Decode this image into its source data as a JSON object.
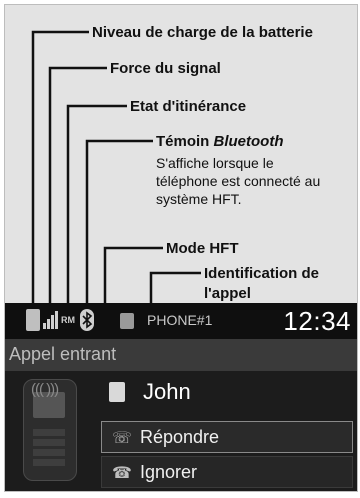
{
  "labels": {
    "battery": "Niveau de charge de la batterie",
    "signal": "Force du signal",
    "roaming": "Etat d'itinérance",
    "bluetooth_title": "Témoin ",
    "bluetooth_italic": "Bluetooth",
    "bluetooth_desc_1": "S'affiche lorsque le",
    "bluetooth_desc_2": "téléphone est connecté au",
    "bluetooth_desc_3": "système HFT.",
    "hft_mode": "Mode HFT",
    "caller_id_1": "Identification de",
    "caller_id_2": "l'appel"
  },
  "screen": {
    "roaming_badge": "RM",
    "phone_name": "PHONE#1",
    "time": "12:34",
    "incoming_title": "Appel entrant",
    "waves": "(((  )))",
    "caller_name": "John",
    "answer_button": "Répondre",
    "ignore_button": "Ignorer"
  },
  "colors": {
    "diagram_background": "#e3e3e3",
    "screen_background": "#1c1c1c",
    "callout_line": "#111111"
  },
  "icons": [
    "battery-icon",
    "signal-icon",
    "roaming-icon",
    "bluetooth-icon",
    "phone-icon",
    "handset-icon",
    "contact-icon",
    "answer-icon",
    "ignore-icon"
  ]
}
